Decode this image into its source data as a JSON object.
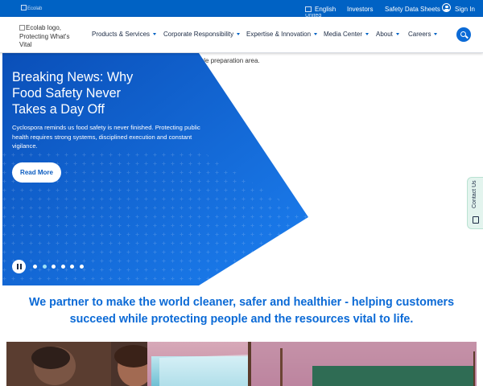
{
  "colors": {
    "utility_bar": "#0062c4",
    "brand_blue": "#0b6ad6",
    "hero_gradient_start": "#0a4fb8",
    "hero_gradient_end": "#1c7ff0",
    "dot_active": "#9fe0f5",
    "contact_tab": "#e3f4ee"
  },
  "utility_bar": {
    "logo_alt": "Ecolab",
    "language": "English",
    "language_sub": "United",
    "links": [
      "Investors",
      "Safety Data Sheets"
    ],
    "signin": "Sign In"
  },
  "header": {
    "logo_alt": "Ecolab logo, Protecting What's Vital",
    "nav": [
      "Products & Services",
      "Corporate Responsibility",
      "Expertise & Innovation",
      "Media Center",
      "About",
      "Careers"
    ],
    "search_icon": "search-icon"
  },
  "hero": {
    "image_alt_fragment": "ove a vegetable preparation area.",
    "title": "Breaking News: Why Food Safety Never Takes a Day Off",
    "description": "Cyclospora reminds us food safety is never finished. Protecting public health requires strong systems, disciplined execution and constant vigilance.",
    "cta": "Read More",
    "carousel": {
      "total_slides": 6,
      "active_slide": 2
    }
  },
  "contact_tab": {
    "label": "Contact Us",
    "icon": "chat-icon"
  },
  "mission": {
    "text": "We partner to make the world cleaner, safer and healthier - helping customers succeed while protecting people and the resources vital to life."
  }
}
